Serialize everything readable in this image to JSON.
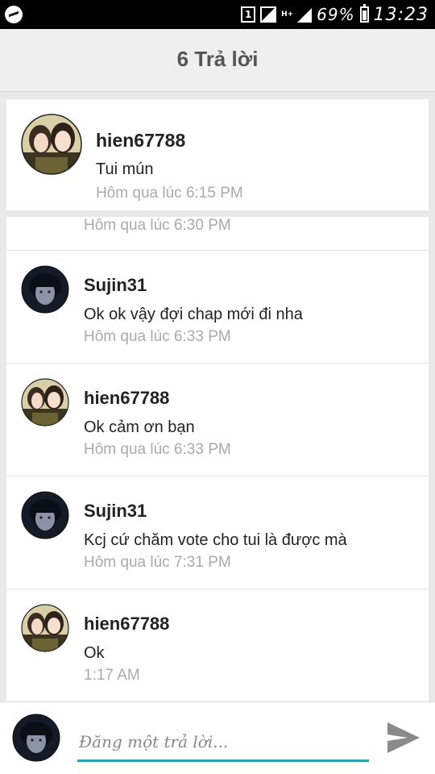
{
  "status_bar": {
    "sim_slot": "1",
    "network_type": "H+",
    "battery_percent": "69%",
    "time": "13:23",
    "icons": [
      "messenger-icon",
      "sim-icon",
      "signal-icon",
      "battery-icon"
    ]
  },
  "header": {
    "title": "6 Trả lời"
  },
  "original_post": {
    "username": "hien67788",
    "text": "Tui mún",
    "time": "Hôm qua lúc 6:15 PM"
  },
  "replies": [
    {
      "username": "",
      "text": "",
      "time": "Hôm qua lúc 6:30 PM"
    },
    {
      "username": "Sujin31",
      "text": "Ok ok vậy đợi chap mới đi nha",
      "time": "Hôm qua lúc 6:33 PM"
    },
    {
      "username": "hien67788",
      "text": "Ok cảm ơn bạn",
      "time": "Hôm qua lúc 6:33 PM"
    },
    {
      "username": "Sujin31",
      "text": "Kcj cứ chăm vote cho tui là được mà",
      "time": "Hôm qua lúc 7:31 PM"
    },
    {
      "username": "hien67788",
      "text": "Ok",
      "time": "1:17 AM"
    }
  ],
  "compose": {
    "placeholder": "Đăng một trả lời...",
    "value": ""
  },
  "colors": {
    "accent": "#2aa3a8",
    "header_bg": "#efefef",
    "timestamp": "#aaaaaa"
  }
}
